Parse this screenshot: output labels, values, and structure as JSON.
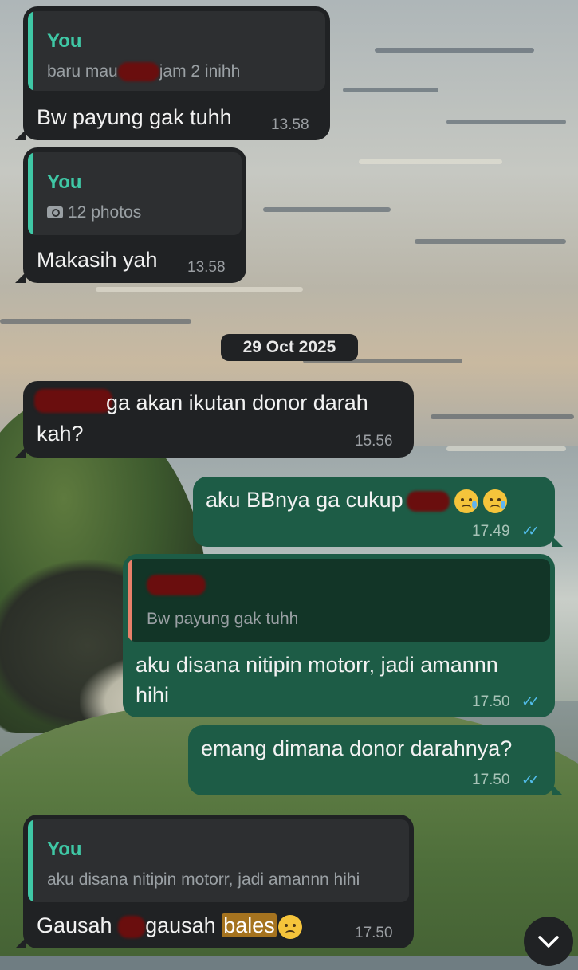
{
  "date_separator": "29 Oct 2025",
  "messages": [
    {
      "direction": "in",
      "reply_author": "You",
      "reply_text_a": "baru mau",
      "reply_text_b": "jam 2 inihh",
      "text": "Bw payung gak tuhh",
      "time": "13.58"
    },
    {
      "direction": "in",
      "reply_author": "You",
      "reply_text": "12 photos",
      "text": "Makasih yah",
      "time": "13.58"
    },
    {
      "direction": "in",
      "text_a": "ga akan ikutan donor darah",
      "text_b": "kah?",
      "time": "15.56"
    },
    {
      "direction": "out",
      "text": "aku BBnya ga cukup",
      "time": "17.49"
    },
    {
      "direction": "out",
      "reply_text": "Bw payung gak tuhh",
      "text_a": "aku disana nitipin motorr, jadi amannn",
      "text_b": "hihi",
      "time": "17.50"
    },
    {
      "direction": "out",
      "text": "emang dimana donor darahnya?",
      "time": "17.50"
    },
    {
      "direction": "in",
      "reply_author": "You",
      "reply_text": "aku disana nitipin motorr, jadi amannn hihi",
      "text_a": "Gausah",
      "text_b": "gausah",
      "text_c": "bales",
      "time": "17.50"
    }
  ],
  "colors": {
    "incoming": "#202224",
    "outgoing": "#1d5c46",
    "quote_bar_self": "#3fc7a5",
    "quote_bar_other": "#e8806a",
    "read_ticks": "#53bdeb"
  },
  "icons": {
    "read": "double-check-icon",
    "photo": "camera-icon",
    "scroll": "chevron-down-icon"
  }
}
